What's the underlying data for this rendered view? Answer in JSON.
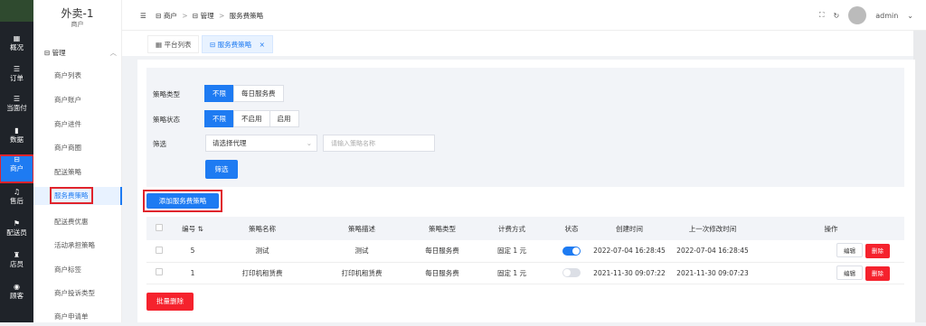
{
  "rail": [
    {
      "icon": "▦",
      "label": "概况"
    },
    {
      "icon": "☰",
      "label": "订单"
    },
    {
      "icon": "☰",
      "label": "当面付"
    },
    {
      "icon": "▮",
      "label": "数据"
    },
    {
      "icon": "⊟",
      "label": "商户"
    },
    {
      "icon": "♫",
      "label": "售后"
    },
    {
      "icon": "⚑",
      "label": "配送员"
    },
    {
      "icon": "♜",
      "label": "店员"
    },
    {
      "icon": "◉",
      "label": "顾客"
    }
  ],
  "brand": {
    "title": "外卖-1",
    "subtitle": "商户"
  },
  "submenu": {
    "group": "管理",
    "items": [
      "商户列表",
      "商户账户",
      "商户进件",
      "商户商圈",
      "配送策略",
      "服务费策略",
      "配送费优惠",
      "活动承担策略",
      "商户标签",
      "商户投诉类型",
      "商户申请单"
    ]
  },
  "header": {
    "crumbs": [
      "商户",
      "管理",
      "服务费策略"
    ],
    "user": "admin"
  },
  "tabs": [
    {
      "label": "平台列表"
    },
    {
      "label": "服务费策略",
      "close": "×"
    }
  ],
  "filter": {
    "type_label": "策略类型",
    "type_options": [
      "不限",
      "每日服务费"
    ],
    "status_label": "策略状态",
    "status_options": [
      "不限",
      "不启用",
      "启用"
    ],
    "screen_label": "筛选",
    "agent_select": "请选择代理",
    "name_placeholder": "请输入策略名称",
    "search_btn": "筛选"
  },
  "add_btn": "添加服务费策略",
  "table": {
    "columns": [
      "编号",
      "策略名称",
      "策略描述",
      "策略类型",
      "计费方式",
      "状态",
      "创建时间",
      "上一次修改时间",
      "操作"
    ],
    "rows": [
      {
        "id": "5",
        "name": "测试",
        "desc": "测试",
        "type": "每日服务费",
        "billing": "固定 1 元",
        "enabled": true,
        "created": "2022-07-04 16:28:45",
        "modified": "2022-07-04 16:28:45"
      },
      {
        "id": "1",
        "name": "打印机租赁费",
        "desc": "打印机租赁费",
        "type": "每日服务费",
        "billing": "固定 1 元",
        "enabled": false,
        "created": "2021-11-30 09:07:22",
        "modified": "2021-11-30 09:07:23"
      }
    ],
    "edit_label": "编辑",
    "delete_label": "删除"
  },
  "bulk_delete": "批量删除",
  "colors": {
    "primary": "#1e7bf2",
    "danger": "#f5222d",
    "highlight": "#e0242c"
  }
}
